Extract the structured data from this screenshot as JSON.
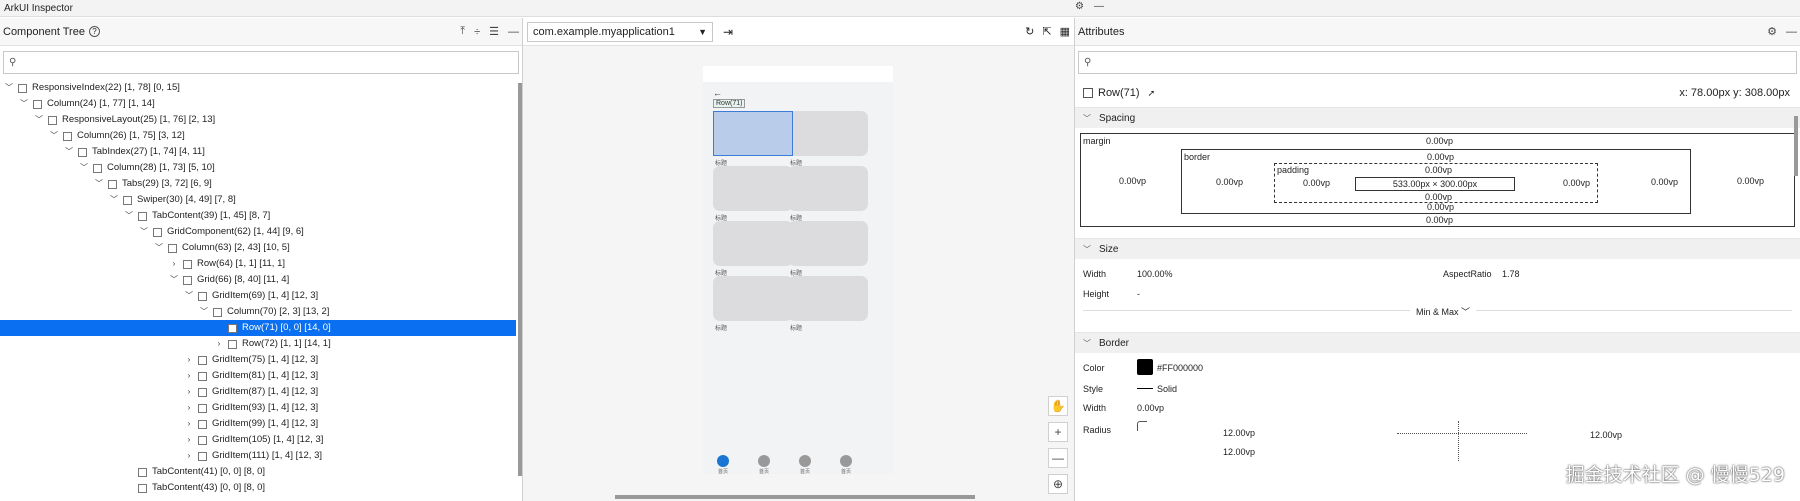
{
  "app_title": "ArkUI Inspector",
  "left": {
    "title": "Component Tree",
    "search_placeholder": "",
    "tree": [
      {
        "d": 0,
        "exp": true,
        "t": "ResponsiveIndex(22) [1, 78] [0, 15]"
      },
      {
        "d": 1,
        "exp": true,
        "t": "Column(24) [1, 77] [1, 14]"
      },
      {
        "d": 2,
        "exp": true,
        "t": "ResponsiveLayout(25) [1, 76] [2, 13]"
      },
      {
        "d": 3,
        "exp": true,
        "t": "Column(26) [1, 75] [3, 12]"
      },
      {
        "d": 4,
        "exp": true,
        "t": "TabIndex(27) [1, 74] [4, 11]"
      },
      {
        "d": 5,
        "exp": true,
        "t": "Column(28) [1, 73] [5, 10]"
      },
      {
        "d": 6,
        "exp": true,
        "t": "Tabs(29) [3, 72] [6, 9]"
      },
      {
        "d": 7,
        "exp": true,
        "t": "Swiper(30) [4, 49] [7, 8]"
      },
      {
        "d": 8,
        "exp": true,
        "t": "TabContent(39) [1, 45] [8, 7]"
      },
      {
        "d": 9,
        "exp": true,
        "t": "GridComponent(62) [1, 44] [9, 6]"
      },
      {
        "d": 10,
        "exp": true,
        "t": "Column(63) [2, 43] [10, 5]"
      },
      {
        "d": 11,
        "exp": false,
        "t": "Row(64) [1, 1] [11, 1]"
      },
      {
        "d": 11,
        "exp": true,
        "t": "Grid(66) [8, 40] [11, 4]"
      },
      {
        "d": 12,
        "exp": true,
        "t": "GridItem(69) [1, 4] [12, 3]"
      },
      {
        "d": 13,
        "exp": true,
        "t": "Column(70) [2, 3] [13, 2]"
      },
      {
        "d": 14,
        "exp": null,
        "t": "Row(71) [0, 0] [14, 0]",
        "sel": true
      },
      {
        "d": 14,
        "exp": false,
        "t": "Row(72) [1, 1] [14, 1]"
      },
      {
        "d": 12,
        "exp": false,
        "t": "GridItem(75) [1, 4] [12, 3]"
      },
      {
        "d": 12,
        "exp": false,
        "t": "GridItem(81) [1, 4] [12, 3]"
      },
      {
        "d": 12,
        "exp": false,
        "t": "GridItem(87) [1, 4] [12, 3]"
      },
      {
        "d": 12,
        "exp": false,
        "t": "GridItem(93) [1, 4] [12, 3]"
      },
      {
        "d": 12,
        "exp": false,
        "t": "GridItem(99) [1, 4] [12, 3]"
      },
      {
        "d": 12,
        "exp": false,
        "t": "GridItem(105) [1, 4] [12, 3]"
      },
      {
        "d": 12,
        "exp": false,
        "t": "GridItem(111) [1, 4] [12, 3]"
      },
      {
        "d": 8,
        "exp": null,
        "t": "TabContent(41) [0, 0] [8, 0]"
      },
      {
        "d": 8,
        "exp": null,
        "t": "TabContent(43) [0, 0] [8, 0]"
      }
    ]
  },
  "mid": {
    "device": "com.example.myapplication1",
    "row_tag": "Row(71)",
    "card_caption": "标题",
    "tab_caption": "首页"
  },
  "right": {
    "title": "Attributes",
    "node": "Row(71)",
    "coords": "x: 78.00px  y: 308.00px",
    "spacing": {
      "title": "Spacing",
      "margin": "margin",
      "border": "border",
      "padding": "padding",
      "val": "0.00vp",
      "content": "533.00px × 300.00px"
    },
    "size": {
      "title": "Size",
      "width_k": "Width",
      "width_v": "100.00%",
      "aspect_k": "AspectRatio",
      "aspect_v": "1.78",
      "height_k": "Height",
      "height_v": "-",
      "minmax": "Min & Max"
    },
    "border": {
      "title": "Border",
      "color_k": "Color",
      "color_v": "#FF000000",
      "style_k": "Style",
      "style_v": "Solid",
      "width_k": "Width",
      "width_v": "0.00vp",
      "radius_k": "Radius",
      "r1": "12.00vp",
      "r2": "12.00vp",
      "r3": "12.00vp"
    }
  },
  "watermark": "掘金技术社区 @ 慢慢529"
}
